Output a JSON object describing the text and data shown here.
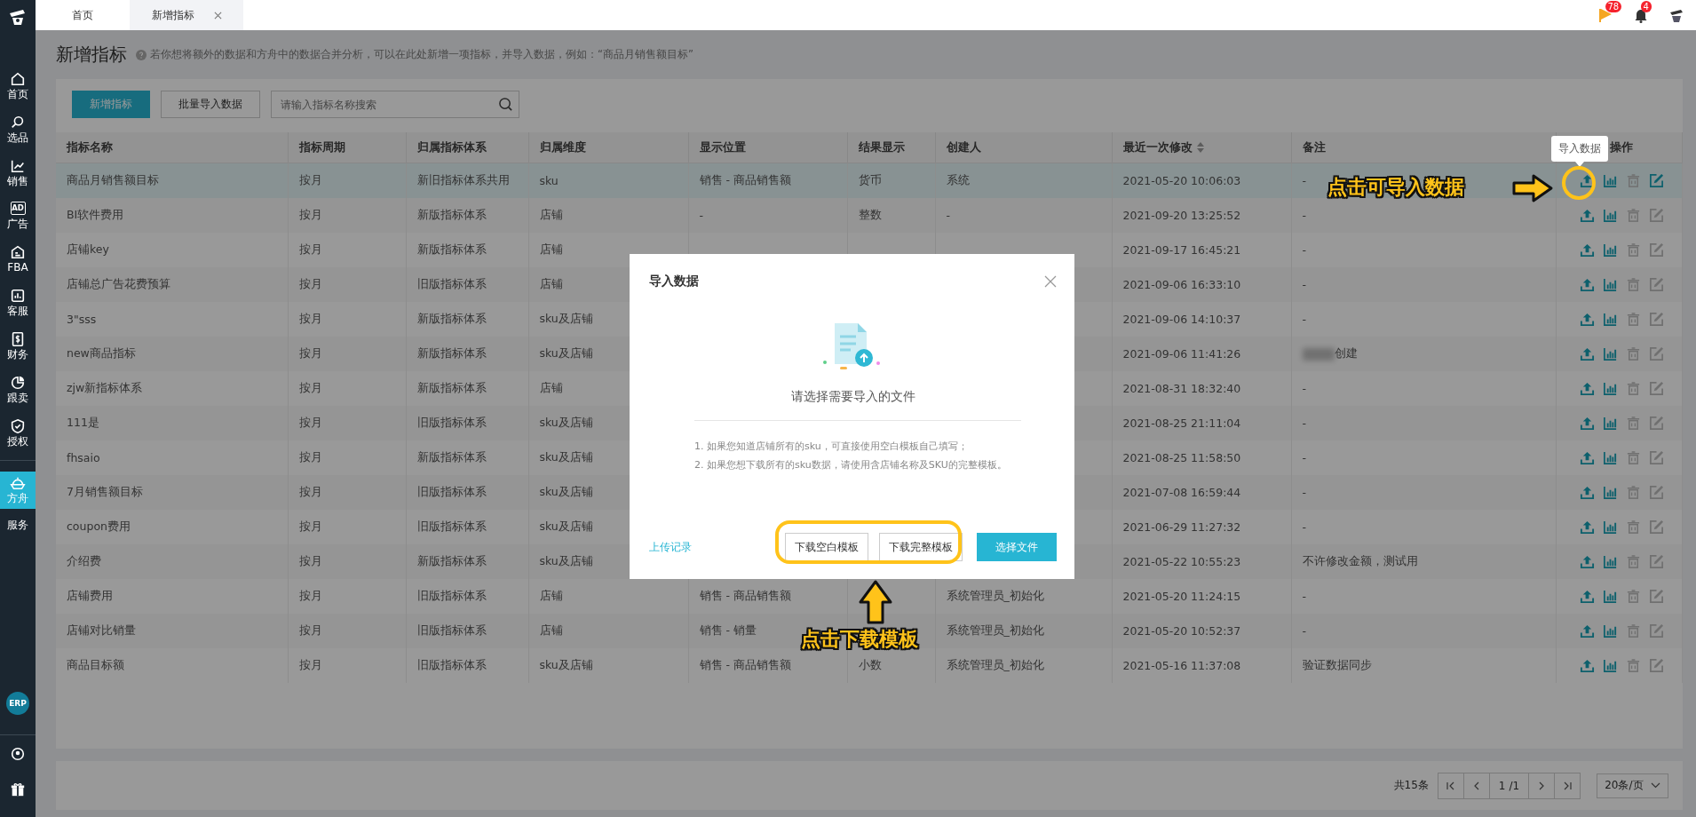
{
  "top_bar": {
    "tabs": [
      {
        "label": "首页",
        "selected": false,
        "closable": false
      },
      {
        "label": "新增指标",
        "selected": true,
        "closable": true
      }
    ],
    "flag_badge": "78",
    "bell_badge": "4"
  },
  "sidebar": {
    "items": [
      {
        "label": "首页",
        "kind": "home",
        "selected": false
      },
      {
        "label": "选品",
        "kind": "search",
        "selected": false
      },
      {
        "label": "销售",
        "kind": "trend",
        "selected": false
      },
      {
        "label": "广告",
        "kind": "ad",
        "icon_text": "AD",
        "selected": false
      },
      {
        "label": "FBA",
        "kind": "fba",
        "selected": false
      },
      {
        "label": "客服",
        "kind": "bars",
        "selected": false
      },
      {
        "label": "财务",
        "kind": "money",
        "selected": false
      },
      {
        "label": "跟卖",
        "kind": "pie",
        "selected": false
      },
      {
        "label": "授权",
        "kind": "shield",
        "selected": false
      },
      {
        "label": "方舟",
        "kind": "ark",
        "selected": true
      },
      {
        "label": "服务",
        "kind": "text",
        "selected": false
      }
    ],
    "badge": "ERP"
  },
  "page": {
    "title": "新增指标",
    "help": "若你想将额外的数据和方舟中的数据合并分析，可以在此处新增一项指标，并导入数据，例如：“商品月销售额目标”"
  },
  "toolbar": {
    "buttons": [
      {
        "label": "新增指标",
        "kind": "primary"
      },
      {
        "label": "批量导入数据",
        "kind": "default"
      }
    ],
    "search": {
      "placeholder": "请输入指标名称搜索"
    }
  },
  "table": {
    "columns": [
      {
        "label": "指标名称",
        "sortable": false
      },
      {
        "label": "指标周期",
        "sortable": false
      },
      {
        "label": "归属指标体系",
        "sortable": false
      },
      {
        "label": "归属维度",
        "sortable": false
      },
      {
        "label": "显示位置",
        "sortable": false
      },
      {
        "label": "结果显示",
        "sortable": false
      },
      {
        "label": "创建人",
        "sortable": false
      },
      {
        "label": "最近一次修改",
        "sortable": true
      },
      {
        "label": "备注",
        "sortable": false
      },
      {
        "label": "操作",
        "sortable": false
      }
    ],
    "rows": [
      {
        "name": "商品月销售额目标",
        "period": "按月",
        "system": "新旧指标体系共用",
        "dimension": "sku",
        "position": "销售 - 商品销售额",
        "result": "货币",
        "creator": "系统",
        "modified": "2021-05-20 10:06:03",
        "note": "-",
        "highlighted": true
      },
      {
        "name": "BI软件费用",
        "period": "按月",
        "system": "新版指标体系",
        "dimension": "店铺",
        "position": "-",
        "result": "整数",
        "creator": "-",
        "modified": "2021-09-20 13:25:52",
        "note": "-",
        "highlighted": false
      },
      {
        "name": "店铺key",
        "period": "按月",
        "system": "新版指标体系",
        "dimension": "店铺",
        "modified": "2021-09-17 16:45:21",
        "note": "-",
        "highlighted": false
      },
      {
        "name": "店铺总广告花费预算",
        "period": "按月",
        "system": "旧版指标体系",
        "dimension": "店铺",
        "modified": "2021-09-06 16:33:10",
        "note": "-",
        "highlighted": false
      },
      {
        "name": "3\"sss",
        "period": "按月",
        "system": "新版指标体系",
        "dimension": "sku及店铺",
        "modified": "2021-09-06 14:10:37",
        "note": "-",
        "highlighted": false
      },
      {
        "name": "new商品指标",
        "period": "按月",
        "system": "新版指标体系",
        "dimension": "sku及店铺",
        "modified": "2021-09-06 11:41:26",
        "note": "创建",
        "note_redacted": true,
        "highlighted": false
      },
      {
        "name": "zjw新指标体系",
        "period": "按月",
        "system": "新版指标体系",
        "dimension": "店铺",
        "modified": "2021-08-31 18:32:40",
        "note": "-",
        "highlighted": false
      },
      {
        "name": "111是",
        "period": "按月",
        "system": "旧版指标体系",
        "dimension": "sku及店铺",
        "modified": "2021-08-25 21:11:04",
        "note": "-",
        "highlighted": false
      },
      {
        "name": "fhsaio",
        "period": "按月",
        "system": "新版指标体系",
        "dimension": "sku及店铺",
        "modified": "2021-08-25 11:58:50",
        "note": "-",
        "highlighted": false
      },
      {
        "name": "7月销售额目标",
        "period": "按月",
        "system": "旧版指标体系",
        "dimension": "sku及店铺",
        "modified": "2021-07-08 16:59:44",
        "note": "-",
        "highlighted": false
      },
      {
        "name": "coupon费用",
        "period": "按月",
        "system": "旧版指标体系",
        "dimension": "sku及店铺",
        "modified": "2021-06-29 11:27:32",
        "note": "-",
        "highlighted": false
      },
      {
        "name": "介绍费",
        "period": "按月",
        "system": "新版指标体系",
        "dimension": "sku及店铺",
        "modified": "2021-05-22 10:55:23",
        "note": "不许修改金额，测试用",
        "highlighted": false
      },
      {
        "name": "店铺费用",
        "period": "按月",
        "system": "旧版指标体系",
        "dimension": "店铺",
        "position": "销售 - 商品销售额",
        "creator": "系统管理员_初始化",
        "modified": "2021-05-20 11:24:15",
        "note": "-",
        "highlighted": false
      },
      {
        "name": "店铺对比销量",
        "period": "按月",
        "system": "旧版指标体系",
        "dimension": "店铺",
        "position": "销售 - 销量",
        "creator": "系统管理员_初始化",
        "modified": "2021-05-20 10:52:37",
        "note": "-",
        "highlighted": false
      },
      {
        "name": "商品目标额",
        "period": "按月",
        "system": "旧版指标体系",
        "dimension": "sku及店铺",
        "position": "销售 - 商品销售额",
        "result": "小数",
        "creator": "系统管理员_初始化",
        "modified": "2021-05-16 11:37:08",
        "note": "验证数据同步",
        "highlighted": false
      }
    ]
  },
  "pagination": {
    "total": "共15条",
    "page": "1",
    "pages": "/1",
    "page_size": "20条/页"
  },
  "tooltip": "导入数据",
  "modal": {
    "title": "导入数据",
    "prompt": "请选择需要导入的文件",
    "notes": [
      "1. 如果您知道店铺所有的sku，可直接使用空白模板自己填写；",
      "2. 如果您想下载所有的sku数据，请使用含店铺名称及SKU的完整模板。"
    ],
    "link": "上传记录",
    "buttons": [
      {
        "label": "下载空白模板",
        "kind": "default"
      },
      {
        "label": "下载完整模板",
        "kind": "default"
      },
      {
        "label": "选择文件",
        "kind": "primary"
      }
    ]
  },
  "annotations": {
    "import_hint": "点击可导入数据",
    "template_hint": "点击下载模板"
  }
}
